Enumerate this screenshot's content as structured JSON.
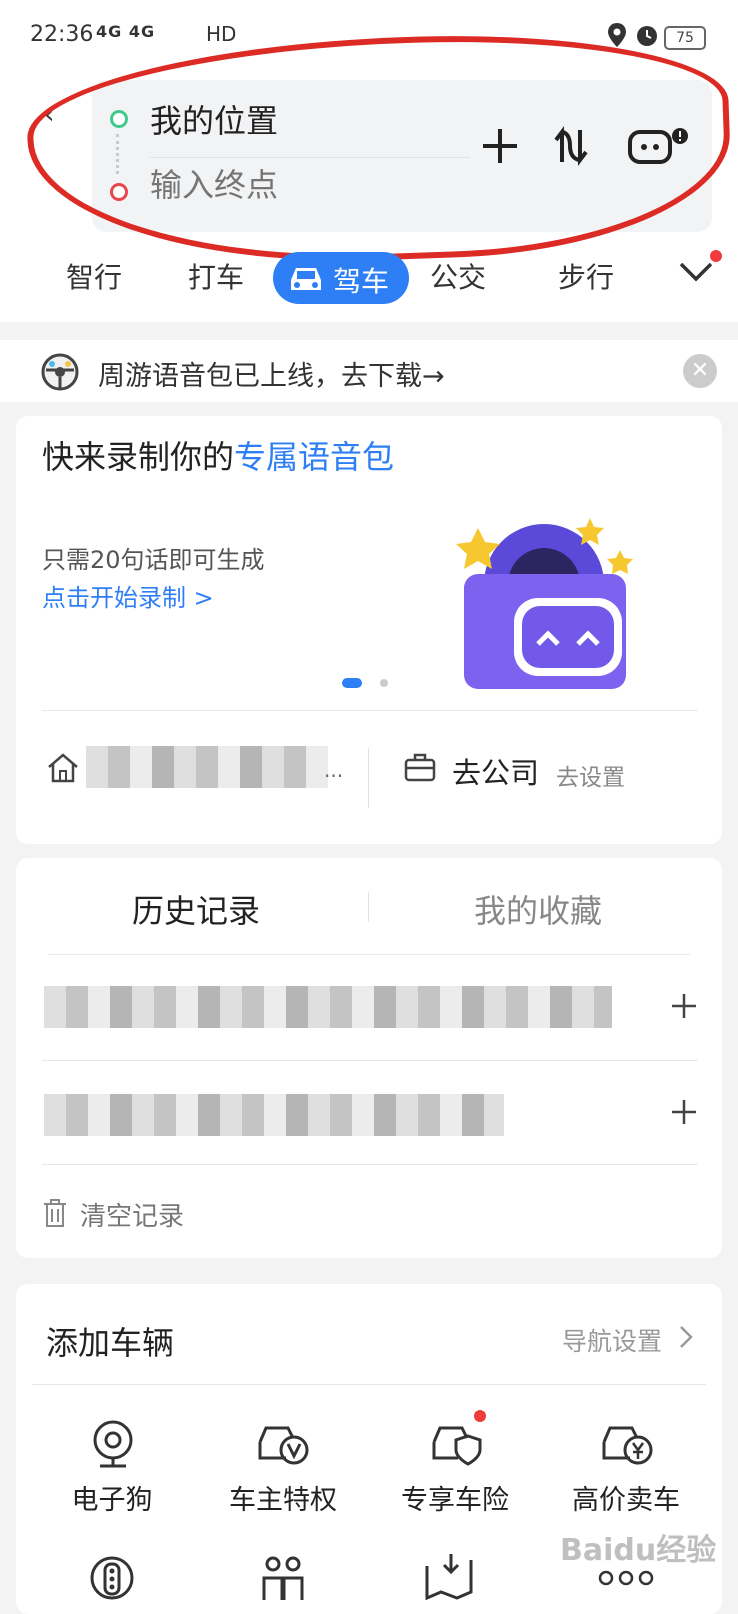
{
  "status_bar": {
    "time": "22:36",
    "network": "4G 4G",
    "hd": "HD",
    "battery": "75"
  },
  "route": {
    "start": "我的位置",
    "end_placeholder": "输入终点"
  },
  "modes": [
    "智行",
    "打车",
    "驾车",
    "公交",
    "步行"
  ],
  "banner": {
    "text": "周游语音包已上线，去下载→"
  },
  "voice_card": {
    "title_prefix": "快来录制你的",
    "title_highlight": "专属语音包",
    "subtitle": "只需20句话即可生成",
    "link": "点击开始录制 >"
  },
  "shortcuts": {
    "home_more": "...",
    "company_label": "去公司",
    "company_action": "去设置"
  },
  "history": {
    "tab_history": "历史记录",
    "tab_favorites": "我的收藏",
    "clear": "清空记录"
  },
  "vehicle": {
    "title": "添加车辆",
    "settings": "导航设置",
    "features": [
      "电子狗",
      "车主特权",
      "专享车险",
      "高价卖车"
    ]
  },
  "watermark": "Baidu经验",
  "colors": {
    "accent": "#2e7ff5",
    "start_dot": "#41c98c",
    "end_dot": "#e5474d",
    "annotation_red": "#dc2b25"
  }
}
